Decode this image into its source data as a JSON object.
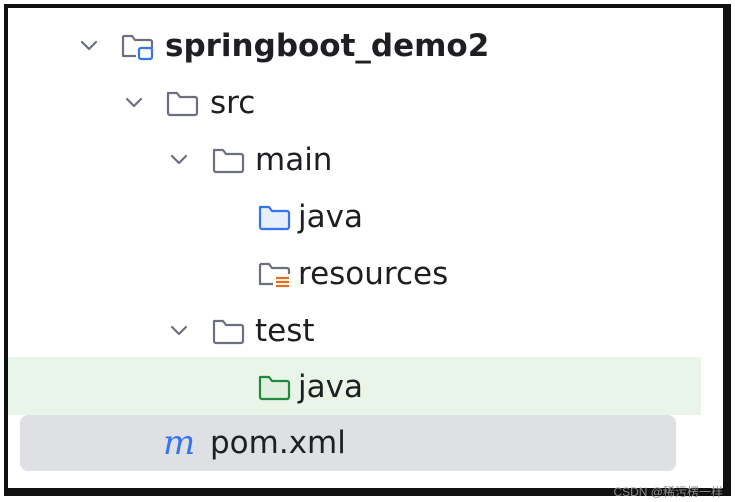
{
  "tree": {
    "items": [
      {
        "label": "springboot_demo2",
        "icon": "module-folder-icon",
        "expanded": true
      },
      {
        "label": "src",
        "icon": "folder-icon",
        "expanded": true
      },
      {
        "label": "main",
        "icon": "folder-icon",
        "expanded": true
      },
      {
        "label": "java",
        "icon": "source-root-folder-icon"
      },
      {
        "label": "resources",
        "icon": "resources-folder-icon"
      },
      {
        "label": "test",
        "icon": "folder-icon",
        "expanded": true
      },
      {
        "label": "java",
        "icon": "test-root-folder-icon"
      },
      {
        "label": "pom.xml",
        "icon": "maven-icon",
        "icon_glyph": "m",
        "selected": true
      }
    ]
  },
  "watermark": "CSDN @稀污楞一样",
  "colors": {
    "folder_stroke": "#6c707e",
    "source_root": "#3574f0",
    "test_root": "#208a3c",
    "resources_lines": "#e66d17",
    "test_highlight": "#e9f5e8",
    "selected_row": "#dfe0e3",
    "maven_m": "#3574f0"
  }
}
